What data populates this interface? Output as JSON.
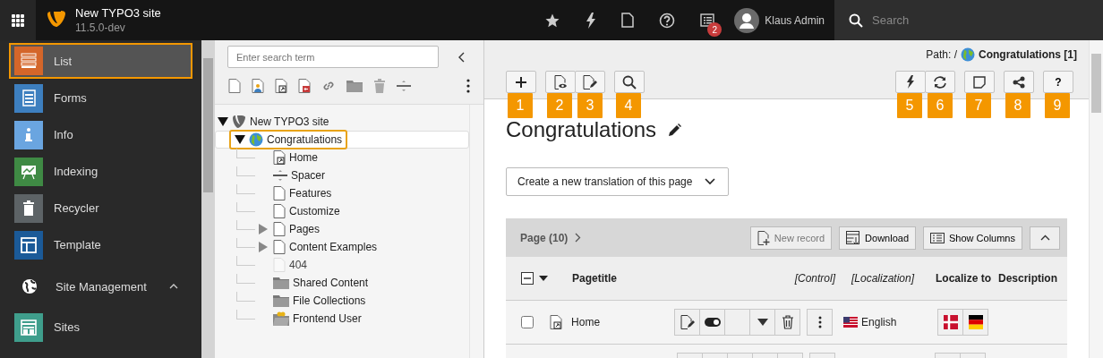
{
  "topbar": {
    "site_name": "New TYPO3 site",
    "version": "11.5.0-dev",
    "notification_count": "2",
    "user_name": "Klaus Admin",
    "search_placeholder": "Search"
  },
  "modules": [
    {
      "label": "List",
      "color": "#d4662a",
      "selected": true
    },
    {
      "label": "Forms",
      "color": "#3d7fbf",
      "selected": false
    },
    {
      "label": "Info",
      "color": "#6aa5e0",
      "selected": false
    },
    {
      "label": "Indexing",
      "color": "#3f8a44",
      "selected": false
    },
    {
      "label": "Recycler",
      "color": "#5d6366",
      "selected": false
    },
    {
      "label": "Template",
      "color": "#1b5a98",
      "selected": false
    }
  ],
  "module_group": {
    "label": "Site Management",
    "expanded": true,
    "items": [
      {
        "label": "Sites",
        "color": "#3f9e8c",
        "selected": false
      }
    ]
  },
  "tree": {
    "search_placeholder": "Enter search term",
    "root": {
      "label": "New TYPO3 site",
      "expanded": true,
      "children": [
        {
          "label": "Congratulations",
          "selected": true,
          "expanded": true,
          "children": [
            {
              "label": "Home",
              "kind": "shortcut",
              "has_children": false,
              "hidden": false
            },
            {
              "label": "Spacer",
              "kind": "spacer",
              "has_children": false,
              "hidden": false
            },
            {
              "label": "Features",
              "kind": "page",
              "has_children": false,
              "hidden": false
            },
            {
              "label": "Customize",
              "kind": "page",
              "has_children": false,
              "hidden": false
            },
            {
              "label": "Pages",
              "kind": "page",
              "has_children": true,
              "hidden": false
            },
            {
              "label": "Content Examples",
              "kind": "page",
              "has_children": true,
              "hidden": false
            },
            {
              "label": "404",
              "kind": "page",
              "has_children": false,
              "hidden": true
            },
            {
              "label": "Shared Content",
              "kind": "folder",
              "has_children": false,
              "hidden": false
            },
            {
              "label": "File Collections",
              "kind": "folder",
              "has_children": false,
              "hidden": false
            },
            {
              "label": "Frontend User",
              "kind": "user-folder",
              "has_children": false,
              "hidden": false
            }
          ]
        }
      ]
    }
  },
  "docheader": {
    "path_label": "Path: /",
    "path_page": "Congratulations [1]",
    "left_groups": [
      [
        {
          "kind": "add",
          "callout": "1"
        }
      ],
      [
        {
          "kind": "view",
          "callout": "2"
        },
        {
          "kind": "edit",
          "callout": "3"
        }
      ],
      [
        {
          "kind": "search",
          "callout": "4"
        }
      ]
    ],
    "right_groups": [
      [
        {
          "kind": "flash",
          "callout": "5"
        },
        {
          "kind": "refresh",
          "callout": "6"
        }
      ],
      [
        {
          "kind": "note",
          "callout": "7"
        }
      ],
      [
        {
          "kind": "share",
          "callout": "8"
        }
      ],
      [
        {
          "kind": "help",
          "label": "?",
          "callout": "9"
        }
      ]
    ]
  },
  "page_title": "Congratulations",
  "translation_dropdown": "Create a new translation of this page",
  "table": {
    "title": "Page (10)",
    "buttons": [
      {
        "kind": "new",
        "label": "New record"
      },
      {
        "kind": "download",
        "label": "Download"
      },
      {
        "kind": "columns",
        "label": "Show Columns"
      }
    ],
    "columns": [
      "Pagetitle",
      "[Control]",
      "[Localization]",
      "Localize to",
      "Description"
    ],
    "rows": [
      {
        "title": "Home",
        "checked": false,
        "language": "English"
      }
    ]
  }
}
